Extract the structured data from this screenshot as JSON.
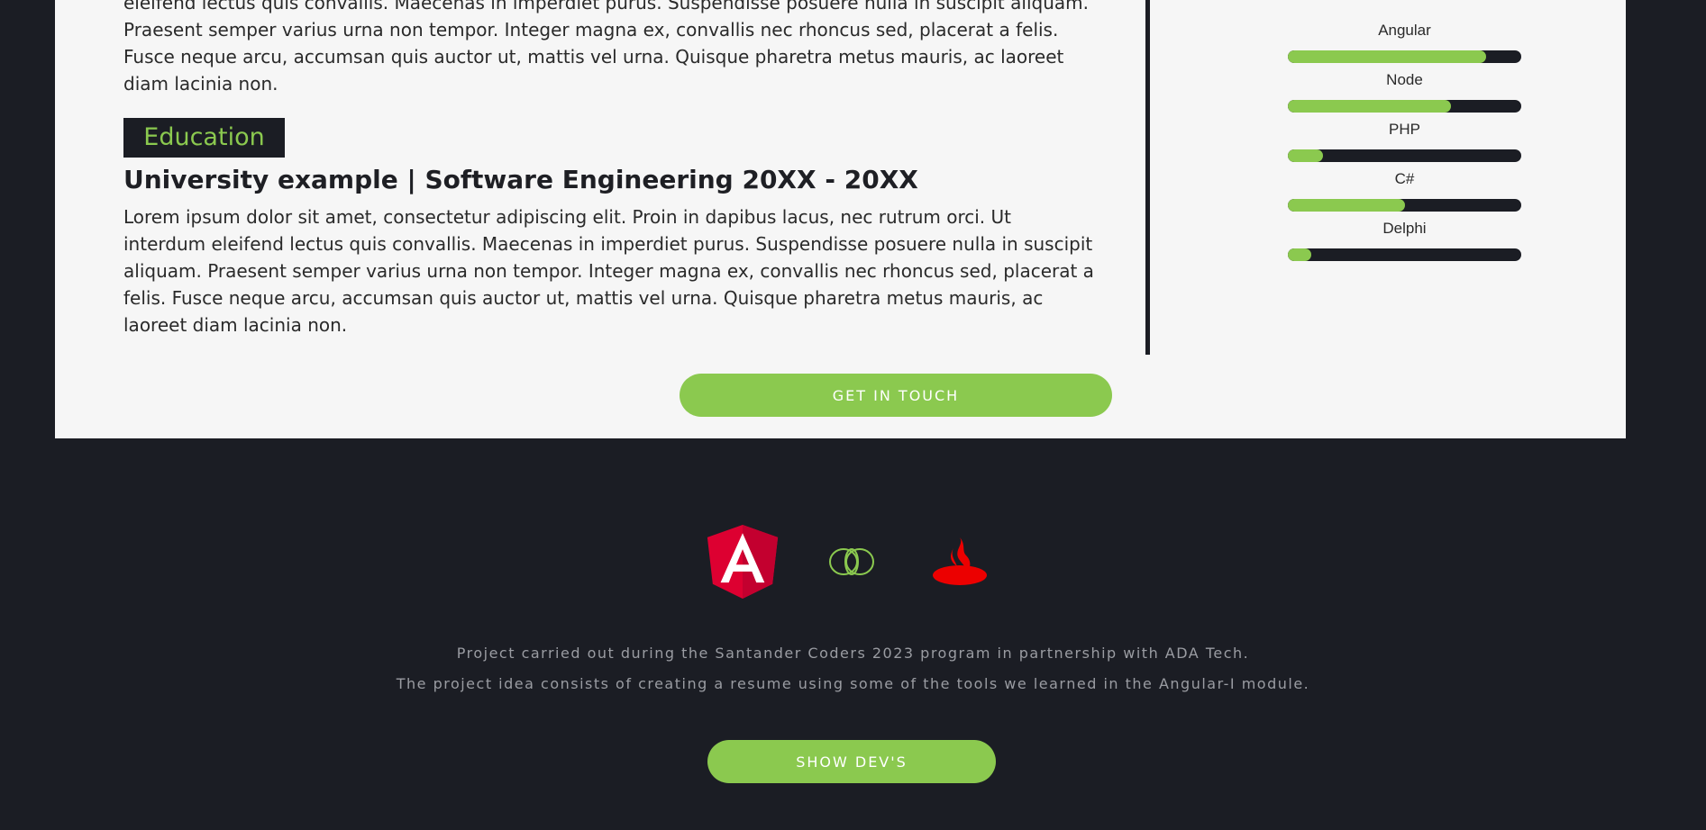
{
  "experience": {
    "paragraph": "eleifend lectus quis convallis. Maecenas in imperdiet purus. Suspendisse posuere nulla in suscipit aliquam. Praesent semper varius urna non tempor. Integer magna ex, convallis nec rhoncus sed, placerat a felis. Fusce neque arcu, accumsan quis auctor ut, mattis vel urna. Quisque pharetra metus mauris, ac laoreet diam lacinia non."
  },
  "education": {
    "badge": "Education",
    "title": "University example | Software Engineering 20XX - 20XX",
    "paragraph": "Lorem ipsum dolor sit amet, consectetur adipiscing elit. Proin in dapibus lacus, nec rutrum orci. Ut interdum eleifend lectus quis convallis. Maecenas in imperdiet purus. Suspendisse posuere nulla in suscipit aliquam. Praesent semper varius urna non tempor. Integer magna ex, convallis nec rhoncus sed, placerat a felis. Fusce neque arcu, accumsan quis auctor ut, mattis vel urna. Quisque pharetra metus mauris, ac laoreet diam lacinia non."
  },
  "skills": [
    {
      "name": "Angular",
      "level": 0.85
    },
    {
      "name": "Node",
      "level": 0.7
    },
    {
      "name": "PHP",
      "level": 0.15
    },
    {
      "name": "C#",
      "level": 0.5
    },
    {
      "name": "Delphi",
      "level": 0.1
    }
  ],
  "buttons": {
    "get_in_touch": "GET IN TOUCH",
    "show_devs": "SHOW DEV'S"
  },
  "footer": {
    "line1": "Project carried out during the Santander Coders 2023 program in partnership with ADA Tech.",
    "line2": "The project idea consists of creating a resume using some of the tools we learned in the Angular-I module.",
    "logos": [
      "angular-icon",
      "ada-tech-icon",
      "santander-icon"
    ]
  },
  "colors": {
    "accent": "#8bc94f",
    "dark": "#1b1d24",
    "card": "#f6f6f6",
    "angular_red": "#dd0031",
    "santander_red": "#ec0000"
  }
}
